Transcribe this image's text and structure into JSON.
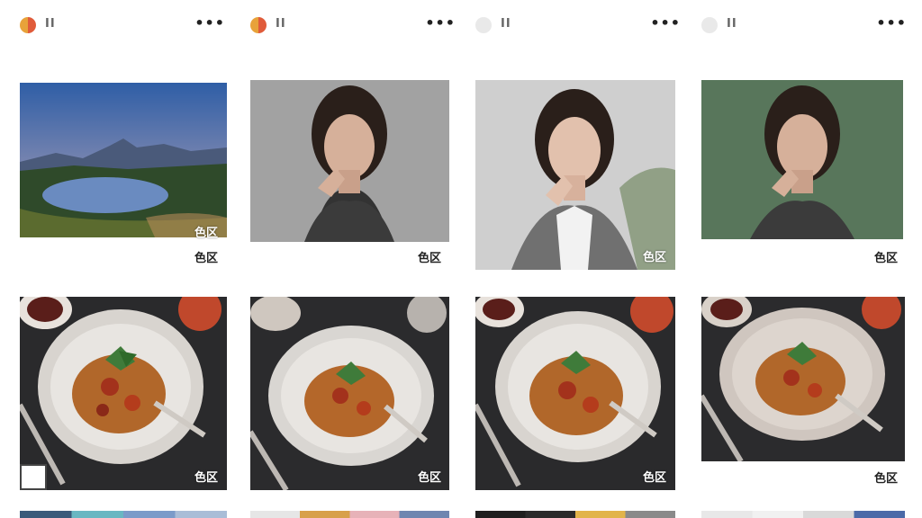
{
  "columns": [
    {
      "header_label": "ΙΙ",
      "more_label": "•••",
      "dot": "warm",
      "cards": [
        {
          "badge": "色区"
        },
        {
          "badge": "色区"
        },
        {
          "badge": "色区"
        }
      ]
    },
    {
      "header_label": "ΙΙ",
      "more_label": "•••",
      "dot": "warm",
      "cards": [
        {
          "badge": "色区"
        },
        {
          "badge": "色区"
        }
      ]
    },
    {
      "header_label": "ΙΙ",
      "more_label": "•••",
      "dot": "cool",
      "cards": [
        {
          "badge": "色区"
        },
        {
          "badge": "色区"
        }
      ]
    },
    {
      "header_label": "ΙΙ",
      "more_label": "•••",
      "dot": "cool",
      "cards": [
        {
          "badge": "色区"
        },
        {
          "badge": "色区"
        }
      ]
    }
  ],
  "colors": {
    "accent_orange": "#e8a23a",
    "accent_red": "#e05b3a",
    "text_dark": "#222222"
  }
}
